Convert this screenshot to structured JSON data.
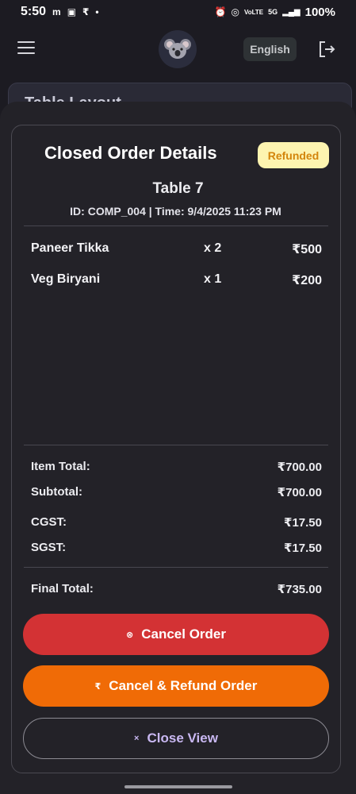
{
  "status_bar": {
    "time": "5:50",
    "left_icons": [
      "m",
      "▣",
      "₹",
      "•"
    ],
    "right_icons": [
      "⏰",
      "◎",
      "VoLTE",
      "5G",
      "▂▄▆"
    ],
    "battery": "100%"
  },
  "appbar": {
    "language": "English",
    "menu_icon": "menu-icon",
    "logo": "koala-logo",
    "logout_icon": "logout-icon"
  },
  "background": {
    "card_title": "Table Layout"
  },
  "dialog": {
    "title": "Closed Order Details",
    "status_badge": "Refunded",
    "table_name": "Table 7",
    "order_meta": "ID: COMP_004 | Time: 9/4/2025 11:23 PM",
    "items": [
      {
        "name": "Paneer Tikka",
        "qty": "x 2",
        "price": "₹500"
      },
      {
        "name": "Veg Biryani",
        "qty": "x 1",
        "price": "₹200"
      }
    ],
    "summary": {
      "item_total_label": "Item Total:",
      "item_total": "₹700.00",
      "subtotal_label": "Subtotal:",
      "subtotal": "₹700.00",
      "cgst_label": "CGST:",
      "cgst": "₹17.50",
      "sgst_label": "SGST:",
      "sgst": "₹17.50",
      "final_total_label": "Final Total:",
      "final_total": "₹735.00"
    },
    "buttons": {
      "cancel_icon": "⊗",
      "cancel": "Cancel Order",
      "refund_icon": "₹",
      "refund": "Cancel & Refund Order",
      "close_icon": "×",
      "close": "Close View"
    }
  },
  "colors": {
    "background": "#1c1b22",
    "sheet": "#232228",
    "badge_bg": "#fdf4b0",
    "badge_text": "#d3850c",
    "cancel": "#d33234",
    "refund": "#f06b06",
    "close_text": "#c9b8f2"
  }
}
